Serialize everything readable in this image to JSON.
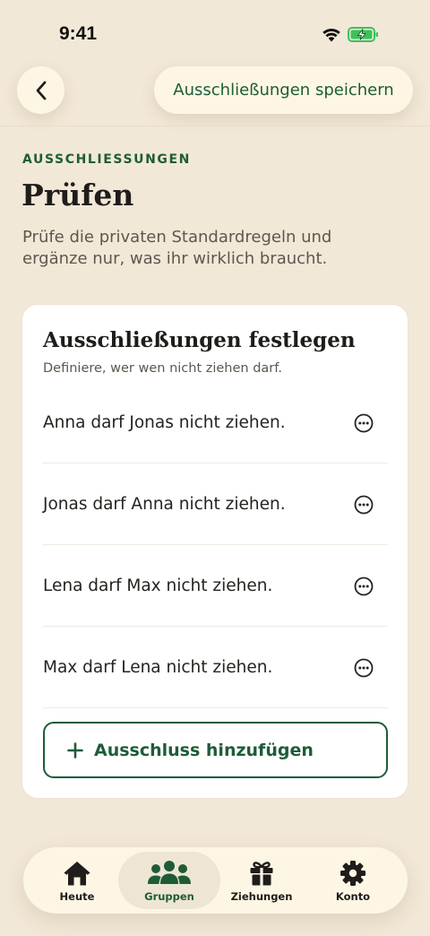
{
  "status_bar": {
    "time": "9:41"
  },
  "nav": {
    "save_label": "Ausschließungen speichern"
  },
  "header": {
    "eyebrow": "AUSSCHLIESSUNGEN",
    "title": "Prüfen",
    "subtitle": "Prüfe die privaten Standardregeln und ergänze nur, was ihr wirklich braucht."
  },
  "card": {
    "title": "Ausschließungen festlegen",
    "subtitle": "Definiere, wer wen nicht ziehen darf.",
    "rules": [
      {
        "text": "Anna darf Jonas nicht ziehen."
      },
      {
        "text": "Jonas darf Anna nicht ziehen."
      },
      {
        "text": "Lena darf Max nicht ziehen."
      },
      {
        "text": "Max darf Lena nicht ziehen."
      }
    ],
    "add_label": "Ausschluss hinzufügen"
  },
  "tabs": [
    {
      "label": "Heute",
      "icon": "home-icon",
      "active": false
    },
    {
      "label": "Gruppen",
      "icon": "group-icon",
      "active": true
    },
    {
      "label": "Ziehungen",
      "icon": "gift-icon",
      "active": false
    },
    {
      "label": "Konto",
      "icon": "gear-icon",
      "active": false
    }
  ],
  "colors": {
    "background": "#f2e8d8",
    "accent_green": "#1e5c38",
    "surface": "#fdf6e4",
    "battery_green": "#3cc25a"
  }
}
